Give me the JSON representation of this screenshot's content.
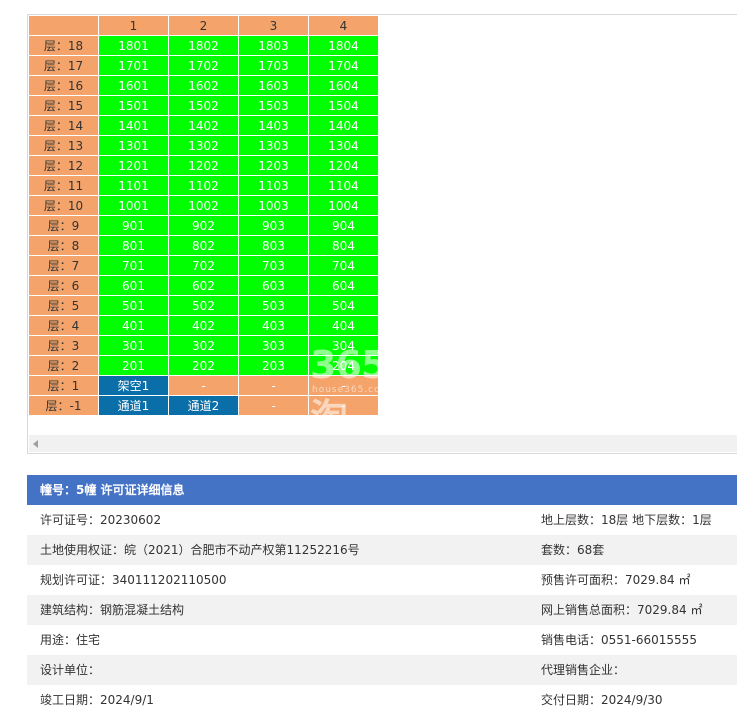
{
  "grid": {
    "columns": [
      "1",
      "2",
      "3",
      "4"
    ],
    "floors": [
      {
        "label": "层：18",
        "units": [
          "1801",
          "1802",
          "1803",
          "1804"
        ]
      },
      {
        "label": "层：17",
        "units": [
          "1701",
          "1702",
          "1703",
          "1704"
        ]
      },
      {
        "label": "层：16",
        "units": [
          "1601",
          "1602",
          "1603",
          "1604"
        ]
      },
      {
        "label": "层：15",
        "units": [
          "1501",
          "1502",
          "1503",
          "1504"
        ]
      },
      {
        "label": "层：14",
        "units": [
          "1401",
          "1402",
          "1403",
          "1404"
        ]
      },
      {
        "label": "层：13",
        "units": [
          "1301",
          "1302",
          "1303",
          "1304"
        ]
      },
      {
        "label": "层：12",
        "units": [
          "1201",
          "1202",
          "1203",
          "1204"
        ]
      },
      {
        "label": "层：11",
        "units": [
          "1101",
          "1102",
          "1103",
          "1104"
        ]
      },
      {
        "label": "层：10",
        "units": [
          "1001",
          "1002",
          "1003",
          "1004"
        ]
      },
      {
        "label": "层：9",
        "units": [
          "901",
          "902",
          "903",
          "904"
        ]
      },
      {
        "label": "层：8",
        "units": [
          "801",
          "802",
          "803",
          "804"
        ]
      },
      {
        "label": "层：7",
        "units": [
          "701",
          "702",
          "703",
          "704"
        ]
      },
      {
        "label": "层：6",
        "units": [
          "601",
          "602",
          "603",
          "604"
        ]
      },
      {
        "label": "层：5",
        "units": [
          "501",
          "502",
          "503",
          "504"
        ]
      },
      {
        "label": "层：4",
        "units": [
          "401",
          "402",
          "403",
          "404"
        ]
      },
      {
        "label": "层：3",
        "units": [
          "301",
          "302",
          "303",
          "304"
        ]
      },
      {
        "label": "层：2",
        "units": [
          "201",
          "202",
          "203",
          "204"
        ]
      },
      {
        "label": "层：1",
        "units": [
          "架空1",
          "-",
          "-",
          "-"
        ],
        "kinds": [
          "blue",
          "empty",
          "empty",
          "empty"
        ]
      },
      {
        "label": "层：-1",
        "units": [
          "通道1",
          "通道2",
          "-",
          "-"
        ],
        "kinds": [
          "blue",
          "blue",
          "empty",
          "empty"
        ]
      }
    ],
    "watermark": {
      "big": "365淘",
      "small": "house365.com"
    }
  },
  "info": {
    "title": "幢号：5幢 许可证详细信息",
    "rows": [
      {
        "left": "许可证号：20230602",
        "right": "地上层数：18层  地下层数：1层"
      },
      {
        "left": "土地使用权证：皖（2021）合肥市不动产权第11252216号",
        "right": "套数：68套"
      },
      {
        "left": "规划许可证：340111202110500",
        "right": "预售许可面积：7029.84 ㎡"
      },
      {
        "left": "建筑结构：钢筋混凝土结构",
        "right": "网上销售总面积：7029.84 ㎡"
      },
      {
        "left": "用途：住宅",
        "right": "销售电话：0551-66015555"
      },
      {
        "left": "设计单位：",
        "right": "代理销售企业："
      },
      {
        "left": "竣工日期：2024/9/1",
        "right": "交付日期：2024/9/30"
      }
    ]
  },
  "colors": {
    "header_orange": "#f4a46a",
    "unit_green": "#00ff00",
    "unit_blue": "#0a6fa8",
    "panel_blue": "#4472c4"
  }
}
